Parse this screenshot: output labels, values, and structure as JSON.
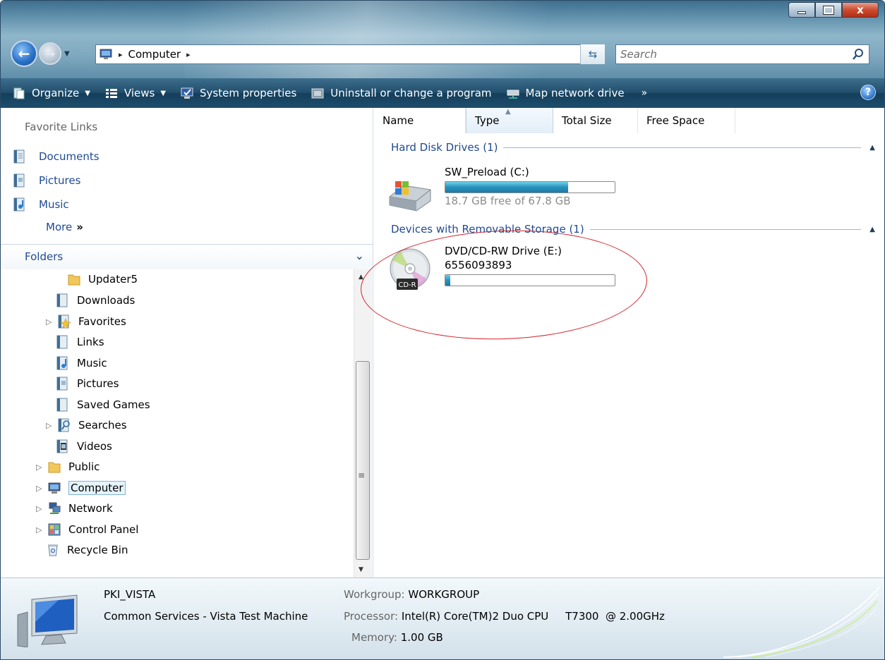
{
  "address_bar": {
    "crumb": "Computer",
    "separator": "▸"
  },
  "search": {
    "placeholder": "Search"
  },
  "window_controls": {
    "close": "x"
  },
  "toolbar": {
    "organize": "Organize",
    "views": "Views",
    "system_properties": "System properties",
    "uninstall": "Uninstall or change a program",
    "map_drive": "Map network drive",
    "more": "»",
    "help": "?"
  },
  "favorites": {
    "header": "Favorite Links",
    "items": [
      {
        "label": "Documents",
        "icon": "documents-icon"
      },
      {
        "label": "Pictures",
        "icon": "pictures-icon"
      },
      {
        "label": "Music",
        "icon": "music-icon"
      }
    ],
    "more": "More",
    "more_glyph": "»"
  },
  "folders": {
    "header": "Folders",
    "tree": [
      {
        "label": "Updater5",
        "icon": "folder-icon"
      },
      {
        "label": "Downloads",
        "icon": "downloads-icon"
      },
      {
        "label": "Favorites",
        "icon": "favorites-icon"
      },
      {
        "label": "Links",
        "icon": "links-icon"
      },
      {
        "label": "Music",
        "icon": "music-icon"
      },
      {
        "label": "Pictures",
        "icon": "pictures-icon"
      },
      {
        "label": "Saved Games",
        "icon": "saved-games-icon"
      },
      {
        "label": "Searches",
        "icon": "searches-icon"
      },
      {
        "label": "Videos",
        "icon": "videos-icon"
      },
      {
        "label": "Public",
        "icon": "folder-icon"
      },
      {
        "label": "Computer",
        "icon": "computer-icon"
      },
      {
        "label": "Network",
        "icon": "network-icon"
      },
      {
        "label": "Control Panel",
        "icon": "control-panel-icon"
      },
      {
        "label": "Recycle Bin",
        "icon": "recycle-bin-icon"
      }
    ]
  },
  "columns": [
    "Name",
    "Type",
    "Total Size",
    "Free Space"
  ],
  "groups": [
    {
      "label": "Hard Disk Drives (1)",
      "drive": {
        "name": "SW_Preload (C:)",
        "free_text": "18.7 GB free of 67.8 GB",
        "used_fraction": 0.724,
        "icon": "hard-disk-icon"
      }
    },
    {
      "label": "Devices with Removable Storage (1)",
      "drive": {
        "name": "DVD/CD-RW Drive (E:)",
        "label": "6556093893",
        "used_fraction": 0.03,
        "icon": "cd-r-icon",
        "icon_text": "CD-R"
      }
    }
  ],
  "details": {
    "computer_name": "PKI_VISTA",
    "description": "Common Services - Vista Test Machine",
    "workgroup_key": "Workgroup:",
    "workgroup_val": "WORKGROUP",
    "processor_key": "Processor:",
    "processor_val": "Intel(R) Core(TM)2 Duo CPU     T7300  @ 2.00GHz",
    "memory_key": "Memory:",
    "memory_val": "1.00 GB"
  },
  "colors": {
    "link": "#1f4a92",
    "annotation": "#d2232a",
    "bar_fill": "#2792bd"
  }
}
